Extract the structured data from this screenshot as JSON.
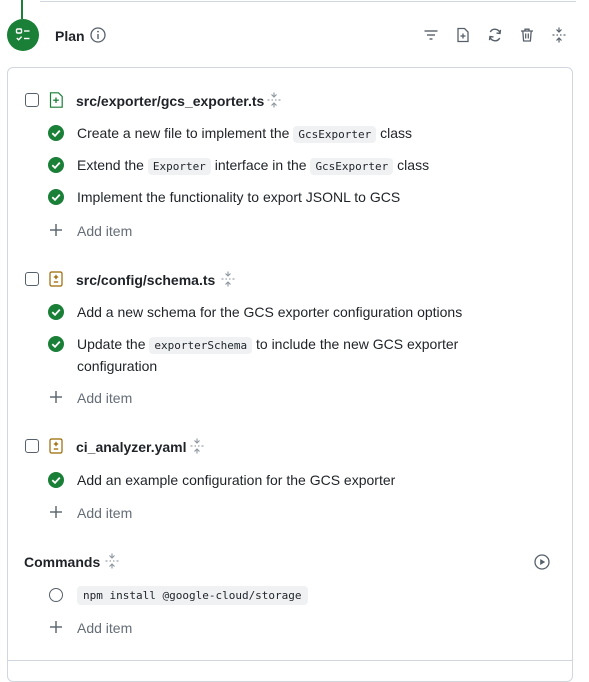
{
  "plan": {
    "title": "Plan",
    "toolbar_icons": [
      "filter-icon",
      "new-file-icon",
      "refresh-icon",
      "trash-icon",
      "collapse-icon"
    ]
  },
  "files": [
    {
      "name": "src/exporter/gcs_exporter.ts",
      "status": "added",
      "items": [
        {
          "segments": [
            "Create a new file to implement the ",
            "GcsExporter",
            " class"
          ]
        },
        {
          "segments": [
            "Extend the ",
            "Exporter",
            " interface in the ",
            "GcsExporter",
            " class"
          ]
        },
        {
          "segments": [
            "Implement the functionality to export JSONL to GCS"
          ]
        }
      ],
      "add_label": "Add item"
    },
    {
      "name": "src/config/schema.ts",
      "status": "modified",
      "items": [
        {
          "segments": [
            "Add a new schema for the GCS exporter configuration options"
          ]
        },
        {
          "segments": [
            "Update the ",
            "exporterSchema",
            " to include the new GCS exporter",
            "configuration"
          ]
        }
      ],
      "add_label": "Add item"
    },
    {
      "name": "ci_analyzer.yaml",
      "status": "modified",
      "items": [
        {
          "segments": [
            "Add an example configuration for the GCS exporter"
          ]
        }
      ],
      "add_label": "Add item"
    }
  ],
  "commands": {
    "title": "Commands",
    "items": [
      "npm install @google-cloud/storage"
    ],
    "add_label": "Add item"
  },
  "colors": {
    "accent_green": "#1a7f37",
    "modified_amber": "#9a6700",
    "border": "#d0d7de",
    "muted": "#656d76"
  }
}
